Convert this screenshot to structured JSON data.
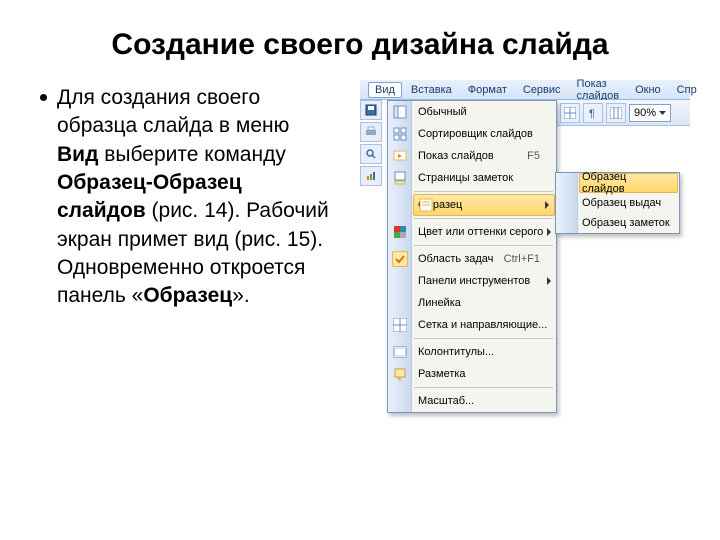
{
  "title": "Создание своего дизайна слайда",
  "para": {
    "t1": "Для создания своего образца слайда в меню ",
    "b1": "Вид",
    "t2": " выберите команду ",
    "b2": "Образец-Образец слайдов",
    "t3": " (рис. 14). Рабочий экран примет вид (рис. 15). Одновременно откроется панель «",
    "b3": "Образец",
    "t4": "»."
  },
  "menubar": {
    "items": [
      "Вид",
      "Вставка",
      "Формат",
      "Сервис",
      "Показ слайдов",
      "Окно",
      "Спр"
    ]
  },
  "toolbar": {
    "zoom": "90%"
  },
  "view_menu": {
    "items": [
      {
        "label": "Обычный",
        "icon": "normal-view-icon"
      },
      {
        "label": "Сортировщик слайдов",
        "icon": "sorter-icon"
      },
      {
        "label": "Показ слайдов",
        "shortcut": "F5",
        "icon": "slideshow-icon"
      },
      {
        "label": "Страницы заметок",
        "icon": "notes-icon"
      },
      {
        "sep": true
      },
      {
        "label": "Образец",
        "icon": "master-icon",
        "arrow": true,
        "hover": true
      },
      {
        "sep": true
      },
      {
        "label": "Цвет или оттенки серого",
        "icon": "color-icon",
        "arrow": true
      },
      {
        "sep": true
      },
      {
        "label": "Область задач",
        "shortcut": "Ctrl+F1",
        "icon": "taskpane-icon",
        "checked": true
      },
      {
        "label": "Панели инструментов",
        "arrow": true
      },
      {
        "label": "Линейка"
      },
      {
        "label": "Сетка и направляющие...",
        "icon": "grid-icon"
      },
      {
        "sep": true
      },
      {
        "label": "Колонтитулы...",
        "icon": "headerfooter-icon"
      },
      {
        "label": "Разметка",
        "icon": "markup-icon"
      },
      {
        "sep": true
      },
      {
        "label": "Масштаб..."
      }
    ]
  },
  "submenu": {
    "items": [
      {
        "label": "Образец слайдов",
        "hover": true
      },
      {
        "label": "Образец выдач"
      },
      {
        "label": "Образец заметок"
      }
    ]
  }
}
